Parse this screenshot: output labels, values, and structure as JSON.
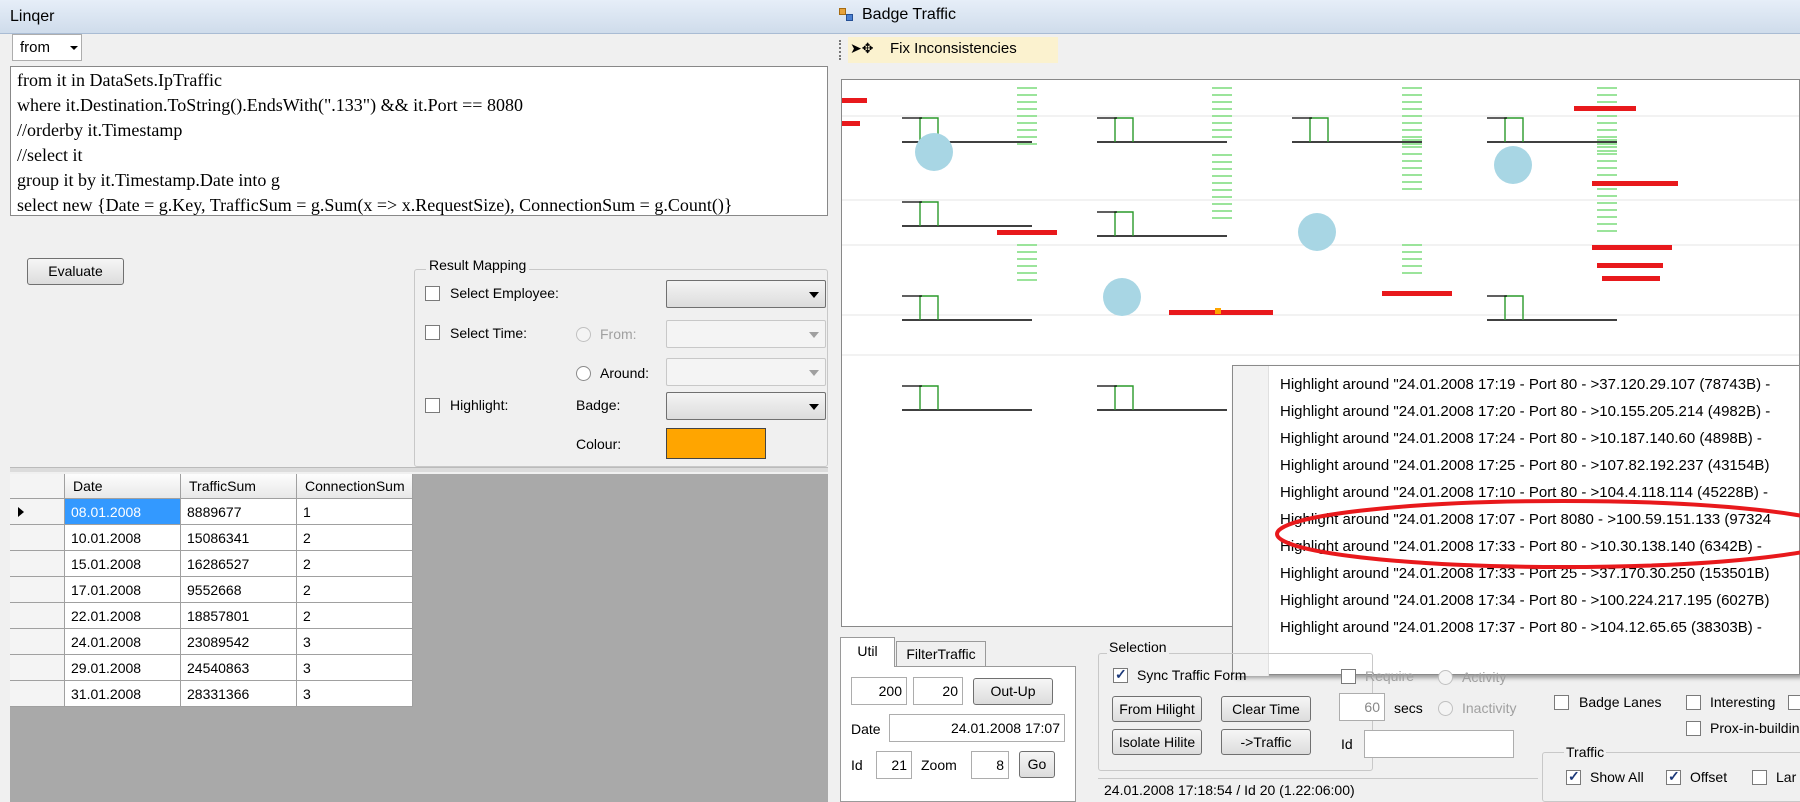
{
  "linqer": {
    "title": "Linqer",
    "mode_select": "from",
    "query_lines": [
      "from it in DataSets.IpTraffic",
      "where it.Destination.ToString().EndsWith(\".133\") && it.Port == 8080",
      "//orderby it.Timestamp",
      "//select it",
      "group it by it.Timestamp.Date into g",
      "select new {Date = g.Key,  TrafficSum = g.Sum(x => x.RequestSize), ConnectionSum = g.Count()}"
    ],
    "evaluate_label": "Evaluate",
    "result_mapping": {
      "title": "Result Mapping",
      "select_employee": "Select Employee:",
      "select_time": "Select Time:",
      "from": "From:",
      "around": "Around:",
      "highlight": "Highlight:",
      "badge": "Badge:",
      "colour": "Colour:",
      "colour_value": "#FFA500"
    },
    "grid": {
      "columns": [
        "Date",
        "TrafficSum",
        "ConnectionSum"
      ],
      "rows": [
        [
          "08.01.2008",
          "8889677",
          "1"
        ],
        [
          "10.01.2008",
          "15086341",
          "2"
        ],
        [
          "15.01.2008",
          "16286527",
          "2"
        ],
        [
          "17.01.2008",
          "9552668",
          "2"
        ],
        [
          "22.01.2008",
          "18857801",
          "2"
        ],
        [
          "24.01.2008",
          "23089542",
          "3"
        ],
        [
          "29.01.2008",
          "24540863",
          "3"
        ],
        [
          "31.01.2008",
          "28331366",
          "3"
        ]
      ],
      "selected_row": 0
    }
  },
  "badge_traffic": {
    "title": "Badge Traffic",
    "toolbar": {
      "fix_label": "Fix Inconsistencies"
    },
    "context_menu": [
      "Highlight around \"24.01.2008 17:19 - Port 80 - >37.120.29.107 (78743B) -",
      "Highlight around \"24.01.2008 17:20 - Port 80 - >10.155.205.214 (4982B) -",
      "Highlight around \"24.01.2008 17:24 - Port 80 - >10.187.140.60 (4898B) -",
      "Highlight around \"24.01.2008 17:25 - Port 80 - >107.82.192.237 (43154B)",
      "Highlight around \"24.01.2008 17:10 - Port 80 - >104.4.118.114 (45228B) -",
      "Highlight around \"24.01.2008 17:07 - Port 8080 - >100.59.151.133 (97324",
      "Highlight around \"24.01.2008 17:33 - Port 80 - >10.30.138.140 (6342B) -",
      "Highlight around \"24.01.2008 17:33 - Port 25 - >37.170.30.250 (153501B)",
      "Highlight around \"24.01.2008 17:34 - Port 80 - >100.224.217.195 (6027B)",
      "Highlight around \"24.01.2008 17:37 - Port 80 - >104.12.65.65 (38303B) -"
    ],
    "tabs": [
      "Util",
      "FilterTraffic"
    ],
    "util": {
      "field1": "200",
      "field2": "20",
      "out_up": "Out-Up",
      "date_label": "Date",
      "date_value": "24.01.2008 17:07",
      "id_label": "Id",
      "id_value": "21",
      "zoom_label": "Zoom",
      "zoom_value": "8",
      "go": "Go"
    },
    "selection": {
      "title": "Selection",
      "sync_label": "Sync Traffic Form",
      "from_hilight": "From Hilight",
      "clear_time": "Clear Time",
      "isolate_hilite": "Isolate Hilite",
      "to_traffic": "->Traffic",
      "require": "Require",
      "activity": "Activity",
      "secs_value": "60",
      "secs": "secs",
      "inactivity": "Inactivity",
      "id_label": "Id"
    },
    "options": {
      "badge_lanes": "Badge Lanes",
      "interesting": "Interesting",
      "prox_in_building": "Prox-in-buildin",
      "traffic_title": "Traffic",
      "show_all": "Show All",
      "offset": "Offset",
      "large": "Lar"
    },
    "status": "24.01.2008 17:18:54 / Id 20 (1.22:06:00)",
    "colors": {
      "highlight_red": "#E8191C",
      "circle_blue": "#A8D6E4",
      "traffic_green": "#5FD45F"
    }
  }
}
